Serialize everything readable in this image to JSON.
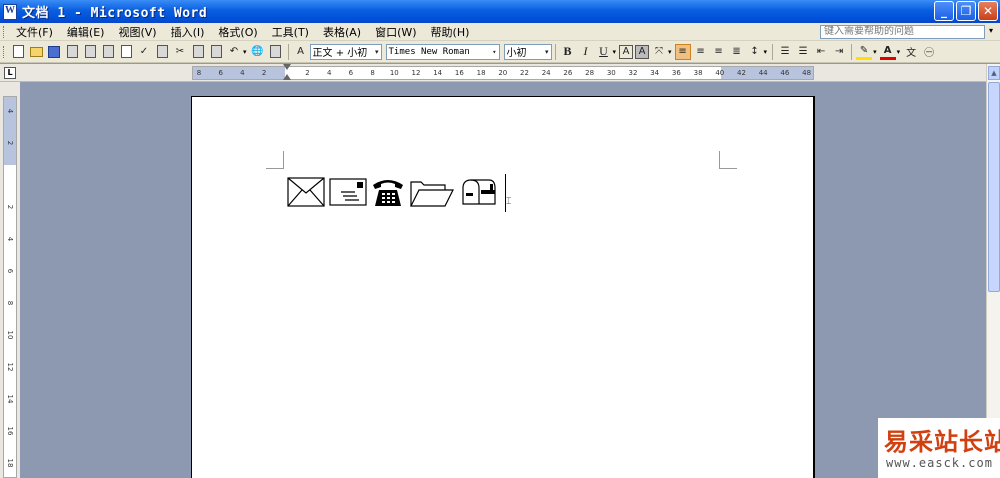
{
  "window": {
    "title": "文档 1 - Microsoft Word",
    "min_label": "_",
    "max_label": "❐",
    "close_label": "✕"
  },
  "menu": {
    "items": [
      "文件(F)",
      "编辑(E)",
      "视图(V)",
      "插入(I)",
      "格式(O)",
      "工具(T)",
      "表格(A)",
      "窗口(W)",
      "帮助(H)"
    ],
    "help_placeholder": "键入需要帮助的问题"
  },
  "toolbar": {
    "style_value": "正文 + 小初",
    "font_value": "Times New Roman",
    "size_value": "小初",
    "bold_label": "B",
    "italic_label": "I",
    "underline_label": "U"
  },
  "ruler": {
    "ticks": [
      "8",
      "6",
      "4",
      "2",
      "",
      "2",
      "4",
      "6",
      "8",
      "10",
      "12",
      "14",
      "16",
      "18",
      "20",
      "22",
      "24",
      "26",
      "28",
      "30",
      "32",
      "34",
      "36",
      "38",
      "40",
      "42",
      "44",
      "46",
      "48"
    ],
    "corner_label": "L"
  },
  "vruler": {
    "ticks": [
      "4",
      "2",
      "",
      "2",
      "4",
      "6",
      "8",
      "10",
      "12",
      "14",
      "16",
      "18"
    ]
  },
  "document": {
    "symbols": [
      "envelope-icon",
      "letter-icon",
      "telephone-icon",
      "folder-icon",
      "mailbox-icon"
    ]
  },
  "watermark": {
    "brand": "易采站长站",
    "url": "www.easck.com"
  },
  "colors": {
    "titlebar": "#0a5fe0",
    "chrome": "#ece9d8",
    "workspace": "#8c99b0",
    "watermark_red": "#d04010"
  }
}
